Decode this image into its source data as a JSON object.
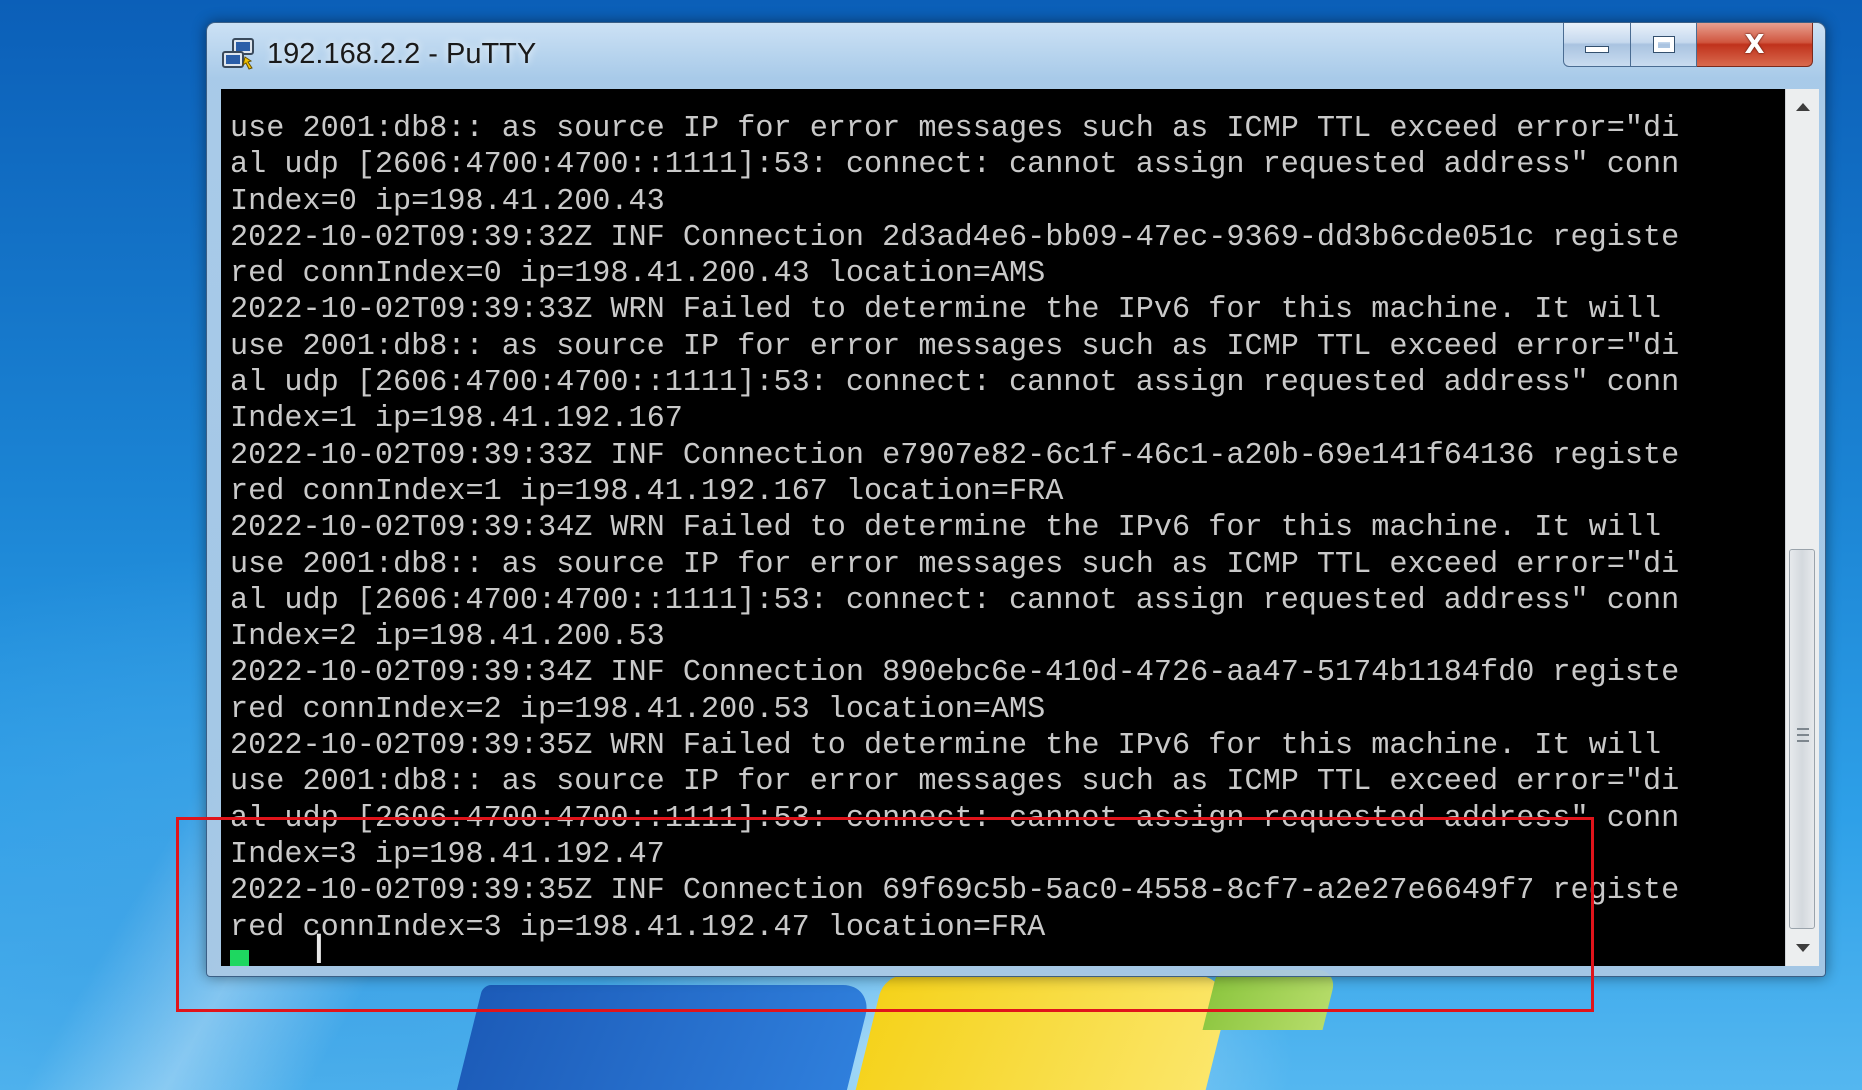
{
  "window": {
    "title": "192.168.2.2 - PuTTY",
    "icon": "putty-icon",
    "buttons": {
      "minimize_icon": "minimize-icon",
      "maximize_icon": "maximize-icon",
      "close_label": "X"
    }
  },
  "terminal": {
    "lines": [
      "use 2001:db8:: as source IP for error messages such as ICMP TTL exceed error=\"di",
      "al udp [2606:4700:4700::1111]:53: connect: cannot assign requested address\" conn",
      "Index=0 ip=198.41.200.43",
      "2022-10-02T09:39:32Z INF Connection 2d3ad4e6-bb09-47ec-9369-dd3b6cde051c registe",
      "red connIndex=0 ip=198.41.200.43 location=AMS",
      "2022-10-02T09:39:33Z WRN Failed to determine the IPv6 for this machine. It will",
      "use 2001:db8:: as source IP for error messages such as ICMP TTL exceed error=\"di",
      "al udp [2606:4700:4700::1111]:53: connect: cannot assign requested address\" conn",
      "Index=1 ip=198.41.192.167",
      "2022-10-02T09:39:33Z INF Connection e7907e82-6c1f-46c1-a20b-69e141f64136 registe",
      "red connIndex=1 ip=198.41.192.167 location=FRA",
      "2022-10-02T09:39:34Z WRN Failed to determine the IPv6 for this machine. It will",
      "use 2001:db8:: as source IP for error messages such as ICMP TTL exceed error=\"di",
      "al udp [2606:4700:4700::1111]:53: connect: cannot assign requested address\" conn",
      "Index=2 ip=198.41.200.53",
      "2022-10-02T09:39:34Z INF Connection 890ebc6e-410d-4726-aa47-5174b1184fd0 registe",
      "red connIndex=2 ip=198.41.200.53 location=AMS",
      "2022-10-02T09:39:35Z WRN Failed to determine the IPv6 for this machine. It will",
      "use 2001:db8:: as source IP for error messages such as ICMP TTL exceed error=\"di",
      "al udp [2606:4700:4700::1111]:53: connect: cannot assign requested address\" conn",
      "Index=3 ip=198.41.192.47",
      "2022-10-02T09:39:35Z INF Connection 69f69c5b-5ac0-4558-8cf7-a2e27e6649f7 registe",
      "red connIndex=3 ip=198.41.192.47 location=FRA"
    ],
    "text_color": "#c9c9c9",
    "background": "#000000",
    "cursor_color": "#1ed760"
  },
  "scrollbar": {
    "up_icon": "scroll-up-arrow-icon",
    "down_icon": "scroll-down-arrow-icon"
  },
  "annotation": {
    "color": "#e0141b"
  }
}
